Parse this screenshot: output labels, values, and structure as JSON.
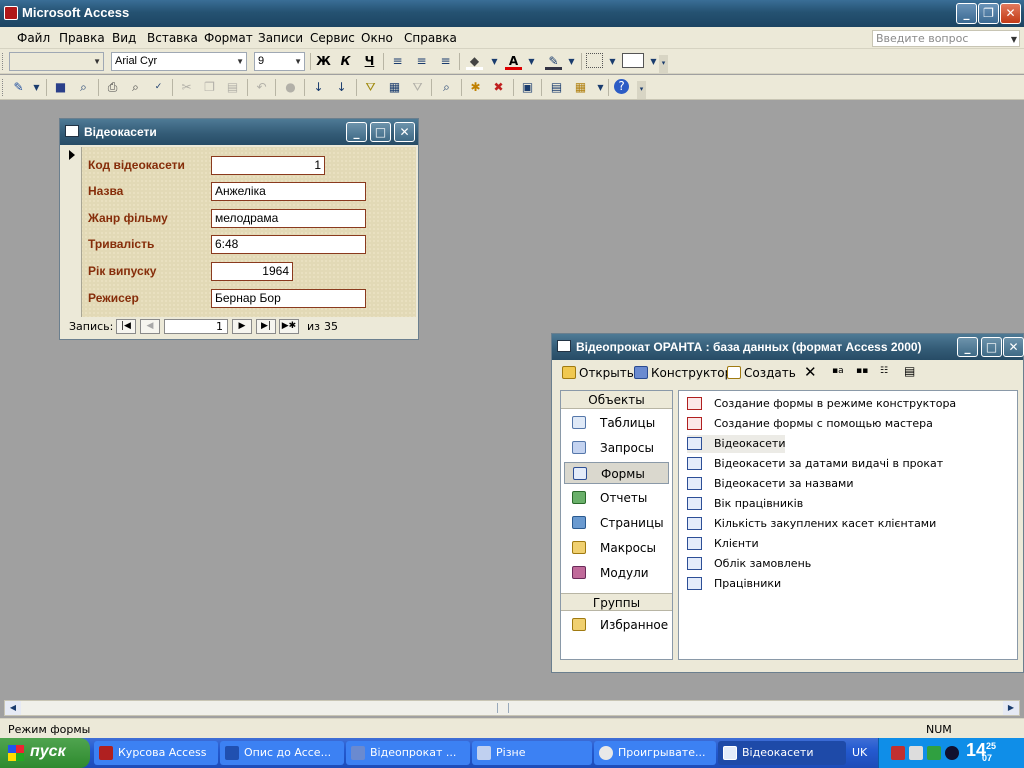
{
  "app": {
    "title": "Microsoft Access",
    "min": "_",
    "restore": "❐",
    "close": "✕"
  },
  "menu": [
    "Файл",
    "Правка",
    "Вид",
    "Вставка",
    "Формат",
    "Записи",
    "Сервис",
    "Окно",
    "Справка"
  ],
  "ask_placeholder": "Введите вопрос",
  "format_toolbar": {
    "font": "Arial Cyr",
    "size": "9",
    "bold": "Ж",
    "italic": "К",
    "underline": "Ч",
    "icons": [
      "align-left-icon",
      "center-icon",
      "align-right-icon",
      "fill-color-icon",
      "font-color-icon",
      "line-color-icon",
      "border-icon",
      "special-effect-icon"
    ]
  },
  "standard_toolbar": {
    "icons": [
      "view-icon",
      "save-icon",
      "search-icon",
      "print-icon",
      "print-preview-icon",
      "spelling-icon",
      "cut-icon",
      "copy-icon",
      "paste-icon",
      "undo-icon",
      "hyperlink-icon",
      "sort-asc-icon",
      "sort-desc-icon",
      "filter-selection-icon",
      "filter-form-icon",
      "apply-filter-icon",
      "find-icon",
      "new-record-icon",
      "delete-record-icon",
      "properties-icon",
      "database-window-icon",
      "new-object-icon",
      "help-icon"
    ]
  },
  "form_window": {
    "title": "Відеокасети",
    "fields": [
      {
        "label": "Код відеокасети",
        "value": "1"
      },
      {
        "label": "Назва",
        "value": "Анжеліка"
      },
      {
        "label": "Жанр фільму",
        "value": "мелодрама"
      },
      {
        "label": "Тривалість",
        "value": "6:48"
      },
      {
        "label": "Рік випуску",
        "value": "1964"
      },
      {
        "label": "Режисер",
        "value": "Бернар Бор"
      }
    ],
    "nav": {
      "label": "Запись:",
      "current": "1",
      "of": "из",
      "total": "35"
    }
  },
  "db_window": {
    "title": "Відеопрокат ОРАНТА : база данных (формат Access 2000)",
    "toolbar": {
      "open": "Открыть",
      "design": "Конструктор",
      "create": "Создать"
    },
    "objects_header": "Объекты",
    "objects": [
      {
        "label": "Таблицы",
        "icon": "tables-icon"
      },
      {
        "label": "Запросы",
        "icon": "queries-icon"
      },
      {
        "label": "Формы",
        "icon": "forms-icon"
      },
      {
        "label": "Отчеты",
        "icon": "reports-icon"
      },
      {
        "label": "Страницы",
        "icon": "pages-icon"
      },
      {
        "label": "Макросы",
        "icon": "macros-icon"
      },
      {
        "label": "Модули",
        "icon": "modules-icon"
      }
    ],
    "groups_header": "Группы",
    "favorites": "Избранное",
    "items": [
      {
        "label": "Создание формы в режиме конструктора",
        "icon": "wizard-icon"
      },
      {
        "label": "Создание формы с помощью мастера",
        "icon": "wizard-icon"
      },
      {
        "label": "Відеокасети",
        "icon": "form-icon"
      },
      {
        "label": "Відеокасети за датами видачі в прокат",
        "icon": "form-icon"
      },
      {
        "label": "Відеокасети за назвами",
        "icon": "form-icon"
      },
      {
        "label": "Вік працівників",
        "icon": "form-icon"
      },
      {
        "label": "Кількість закуплених касет клієнтами",
        "icon": "form-icon"
      },
      {
        "label": "Клієнти",
        "icon": "form-icon"
      },
      {
        "label": "Облік замовлень",
        "icon": "form-icon"
      },
      {
        "label": "Працівники",
        "icon": "form-icon"
      }
    ]
  },
  "status": {
    "mode": "Режим формы",
    "num": "NUM"
  },
  "taskbar": {
    "start": "пуск",
    "tasks": [
      "Курсова Access",
      "Опис до Acce...",
      "Відеопрокат ...",
      "Різне",
      "Проигрывате...",
      "Відеокасети"
    ],
    "lang": "UK",
    "clock_hour": "14",
    "clock_min": "25",
    "clock_day": "07"
  },
  "colors": {
    "label_text": "#862d0a",
    "title_bar": "#345c77",
    "taskbar": "#245ad0"
  }
}
